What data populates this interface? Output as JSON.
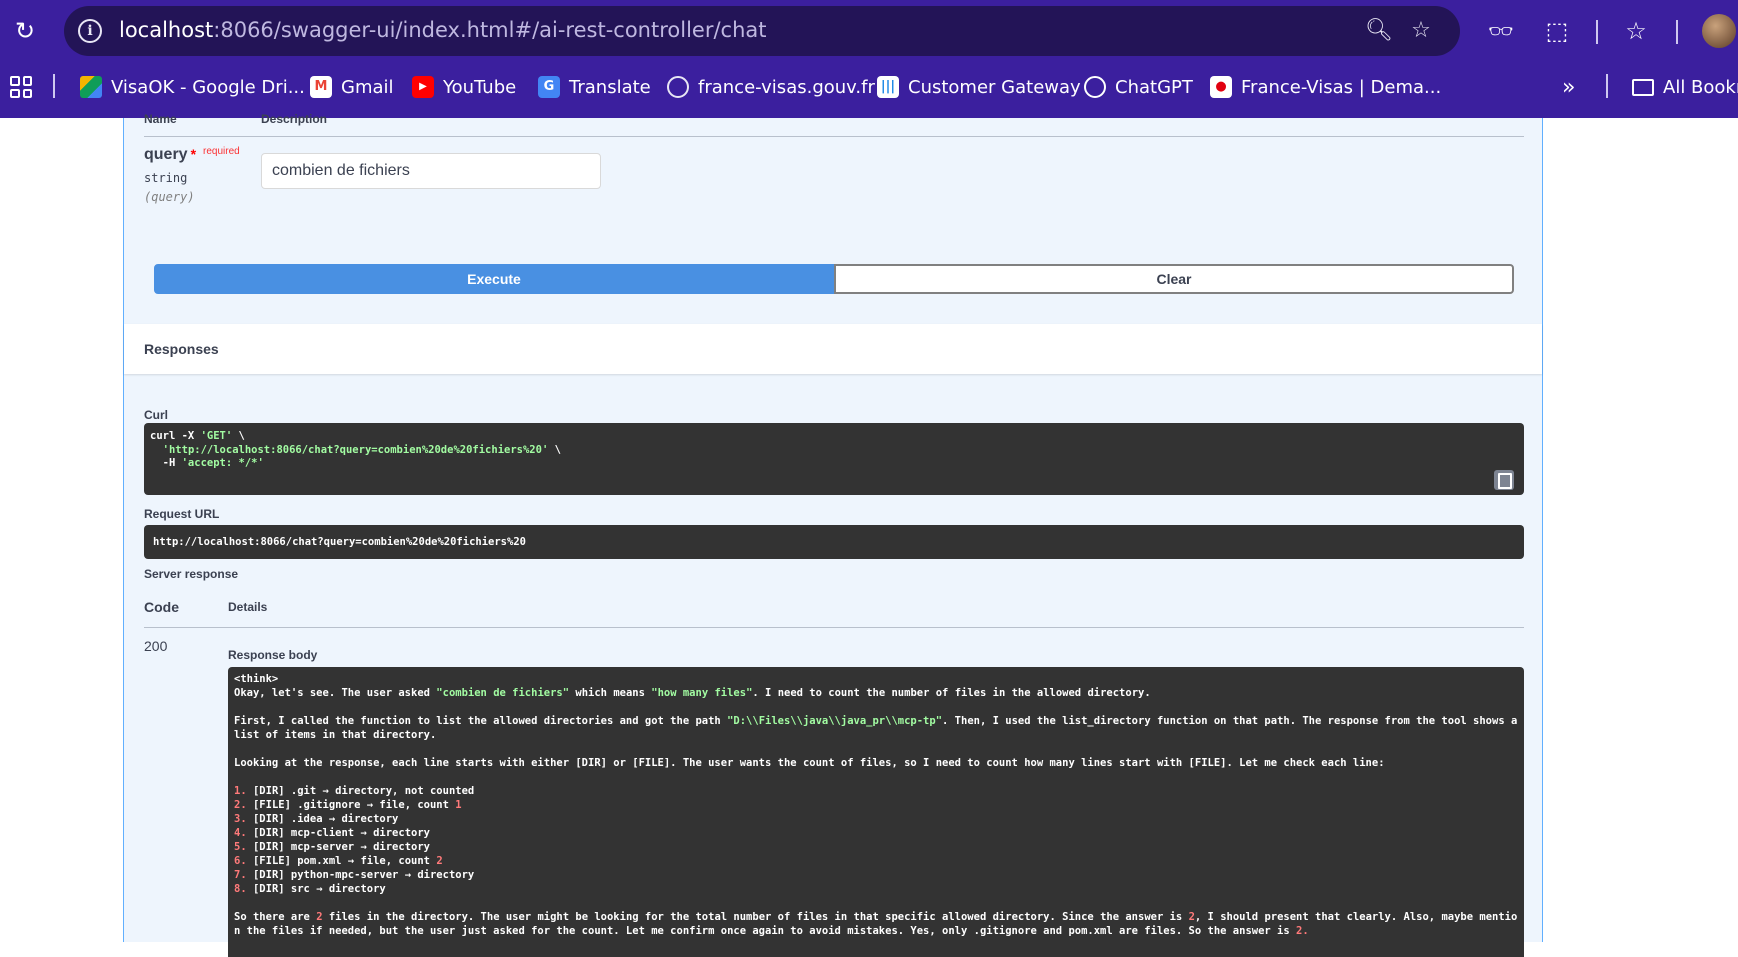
{
  "browser": {
    "url_host": "localhost",
    "url_rest": ":8066/swagger-ui/index.html#/ai-rest-controller/chat",
    "bookmarks": [
      {
        "label": "VisaOK - Google Dri...",
        "icon": "google-drive-icon",
        "color": "#f4b400"
      },
      {
        "label": "Gmail",
        "icon": "gmail-icon",
        "color": "#ea4335"
      },
      {
        "label": "YouTube",
        "icon": "youtube-icon",
        "color": "#ff0000"
      },
      {
        "label": "Translate",
        "icon": "translate-icon",
        "color": "#4285f4"
      },
      {
        "label": "france-visas.gouv.fr",
        "icon": "globe-icon",
        "color": "#e8e6f4"
      },
      {
        "label": "Customer Gateway",
        "icon": "gateway-icon",
        "color": "#1e88e5"
      },
      {
        "label": "ChatGPT",
        "icon": "chatgpt-icon",
        "color": "#ffffff"
      },
      {
        "label": "France-Visas | Dema...",
        "icon": "marianne-icon",
        "color": "#e1000f"
      }
    ],
    "all_bookmarks": "All Bookm"
  },
  "params": {
    "header_name": "Name",
    "header_desc": "Description",
    "name": "query",
    "required_star": "*",
    "required": "required",
    "type": "string",
    "in": "(query)",
    "value": "combien de fichiers"
  },
  "buttons": {
    "execute": "Execute",
    "clear": "Clear"
  },
  "responses": {
    "title": "Responses",
    "curl_label": "Curl",
    "curl": {
      "line1_a": "curl -X ",
      "line1_b": "'GET'",
      "line1_c": " \\",
      "line2_a": "  ",
      "line2_b": "'http://localhost:8066/chat?query=combien%20de%20fichiers%20'",
      "line2_c": " \\",
      "line3_a": "  -H ",
      "line3_b": "'accept: */*'"
    },
    "request_url_label": "Request URL",
    "request_url": "http://localhost:8066/chat?query=combien%20de%20fichiers%20",
    "server_response_label": "Server response",
    "code_header": "Code",
    "details_header": "Details",
    "code": "200",
    "body_label": "Response body",
    "body": {
      "think": "<think>",
      "l1a": "Okay, let's see. The user asked ",
      "l1b": "\"combien de fichiers\"",
      "l1c": " which means ",
      "l1d": "\"how many files\"",
      "l1e": ". I need to count the number of files in the allowed directory.",
      "l2a": "First, I called the function to list the allowed directories and got the path ",
      "l2b": "\"D:\\\\Files\\\\java\\\\java_pr\\\\mcp-tp\"",
      "l2c": ". Then, I used the list_directory function on that path. The response from the tool shows a list of items in that directory.",
      "l3": "Looking at the response, each line starts with either [DIR] or [FILE]. The user wants the count of files, so I need to count how many lines start with [FILE]. Let me check each line:",
      "items": [
        {
          "num": "1.",
          "text": " [DIR] .git → directory, not counted",
          "count": ""
        },
        {
          "num": "2.",
          "text": " [FILE] .gitignore → file, count ",
          "count": "1"
        },
        {
          "num": "3.",
          "text": " [DIR] .idea → directory",
          "count": ""
        },
        {
          "num": "4.",
          "text": " [DIR] mcp-client → directory",
          "count": ""
        },
        {
          "num": "5.",
          "text": " [DIR] mcp-server → directory",
          "count": ""
        },
        {
          "num": "6.",
          "text": " [FILE] pom.xml → file, count ",
          "count": "2"
        },
        {
          "num": "7.",
          "text": " [DIR] python-mpc-server → directory",
          "count": ""
        },
        {
          "num": "8.",
          "text": " [DIR] src → directory",
          "count": ""
        }
      ],
      "l4a": "So there are ",
      "l4b": "2",
      "l4c": " files in the directory. The user might be looking for the total number of files in that specific allowed directory. Since the answer is ",
      "l4d": "2",
      "l4e": ", I should present that clearly. Also, maybe mention the files if needed, but the user just asked for the count. Let me confirm once again to avoid mistakes. Yes, only .gitignore and pom.xml are files. So the answer is ",
      "l4f": "2.",
      "l4g": ""
    }
  }
}
